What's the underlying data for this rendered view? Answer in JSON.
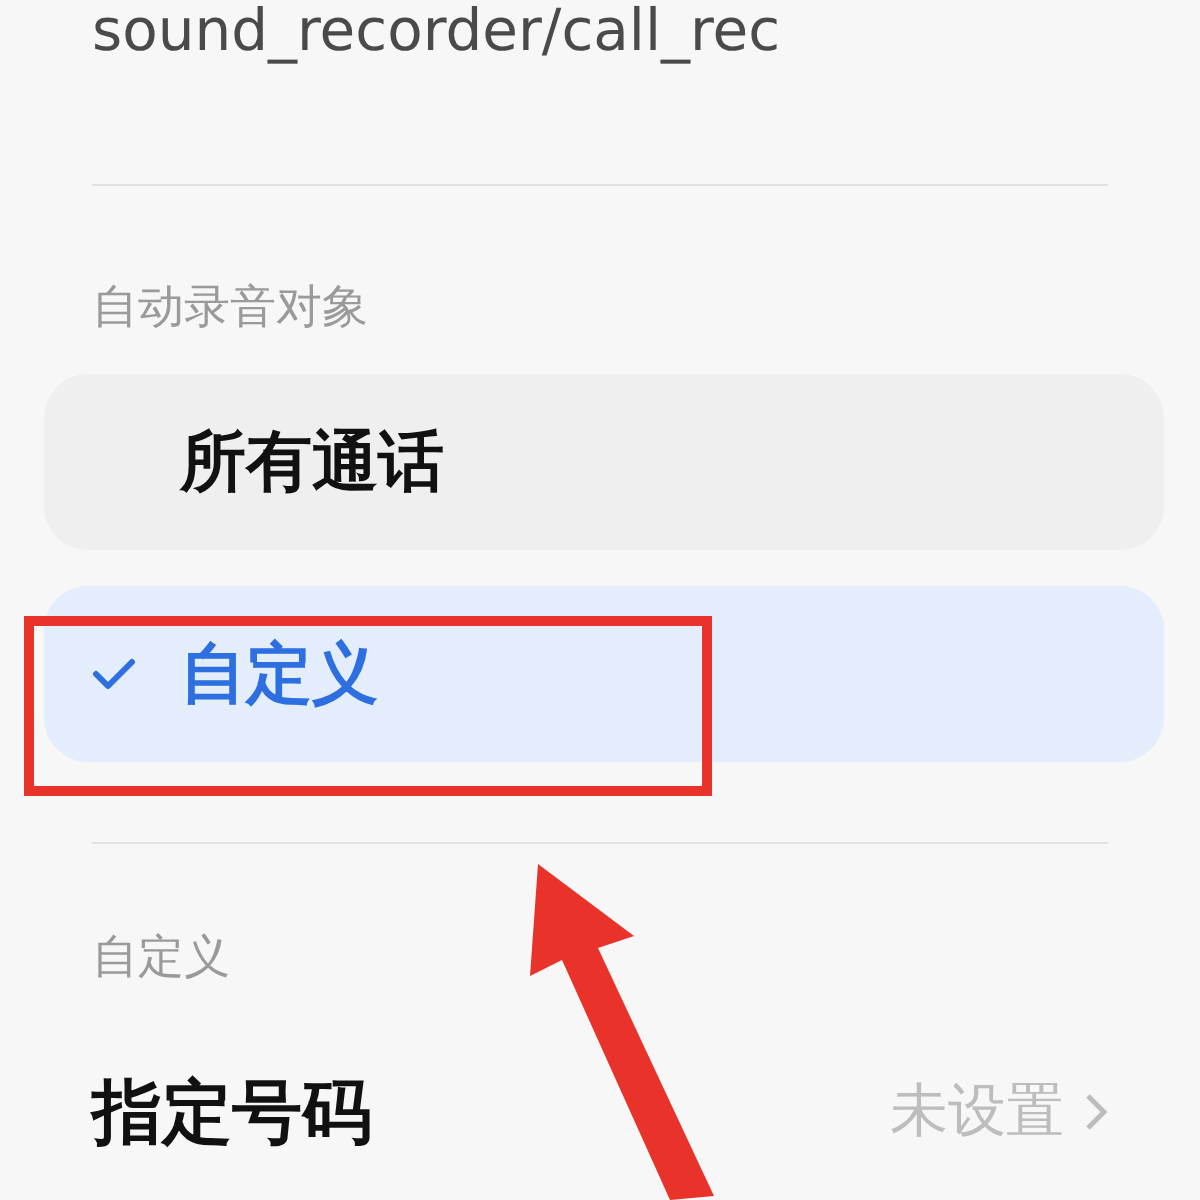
{
  "path": "sound_recorder/call_rec",
  "section": {
    "label": "自动录音对象",
    "options": [
      {
        "label": "所有通话",
        "selected": false
      },
      {
        "label": "自定义",
        "selected": true
      }
    ]
  },
  "custom": {
    "label": "自定义",
    "row": {
      "title": "指定号码",
      "value": "未设置"
    }
  }
}
